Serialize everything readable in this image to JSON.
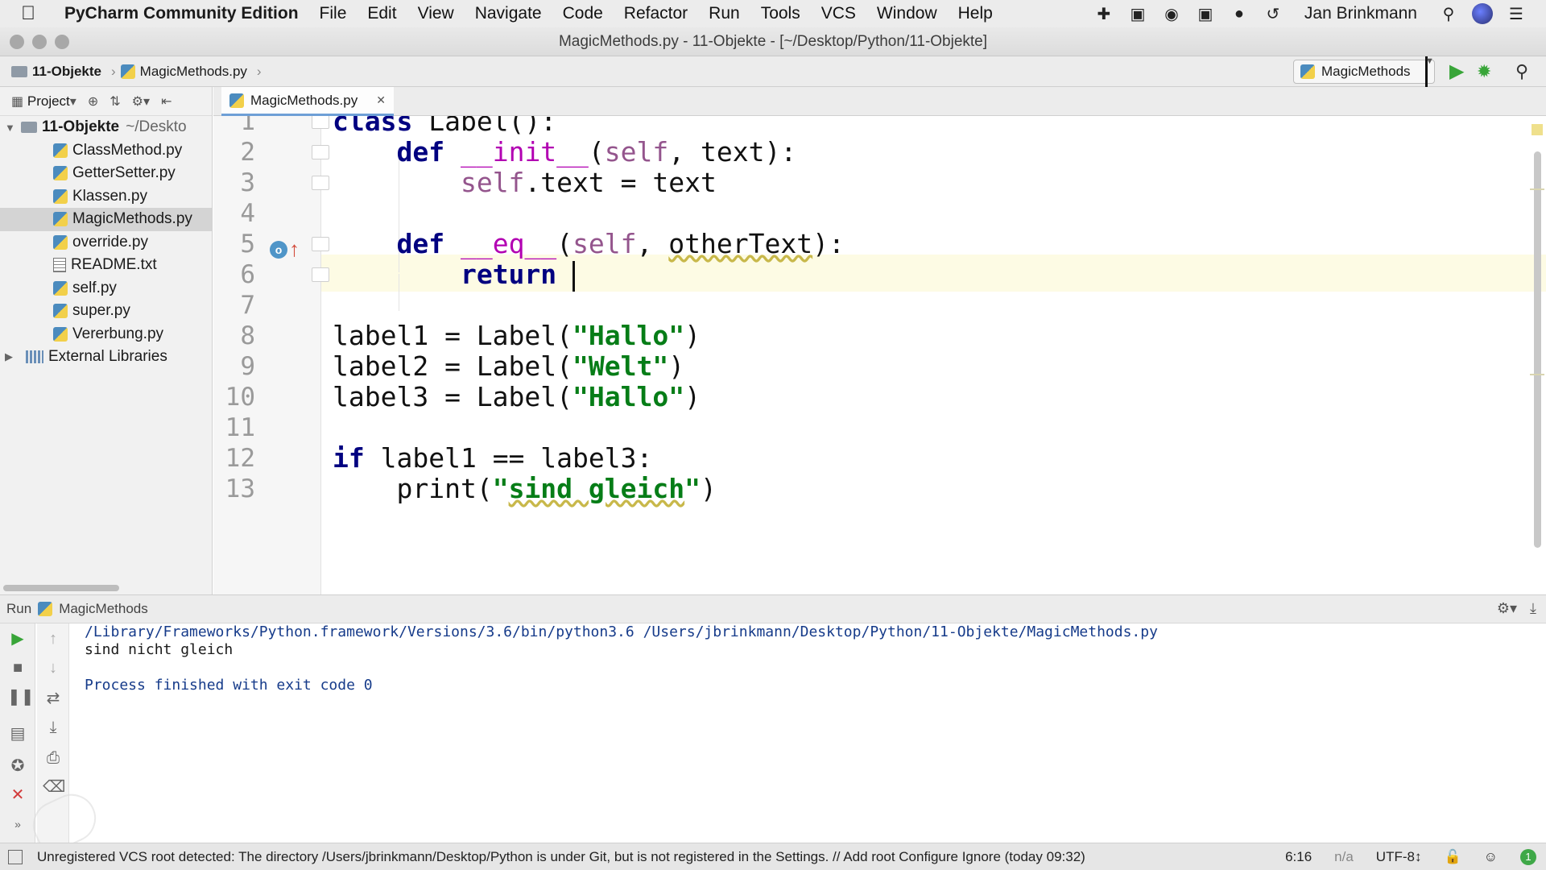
{
  "menubar": {
    "apple_icon": "apple-icon",
    "app_name": "PyCharm Community Edition",
    "items": [
      "File",
      "Edit",
      "View",
      "Navigate",
      "Code",
      "Refactor",
      "Run",
      "Tools",
      "VCS",
      "Window",
      "Help"
    ],
    "user_name": "Jan Brinkmann"
  },
  "window": {
    "title": "MagicMethods.py - 11-Objekte - [~/Desktop/Python/11-Objekte]"
  },
  "navbar": {
    "breadcrumb": [
      "11-Objekte",
      "MagicMethods.py"
    ],
    "run_config": "MagicMethods"
  },
  "project": {
    "label": "Project",
    "root_name": "11-Objekte",
    "root_path": "~/Deskto",
    "files": [
      {
        "name": "ClassMethod.py",
        "type": "py"
      },
      {
        "name": "GetterSetter.py",
        "type": "py"
      },
      {
        "name": "Klassen.py",
        "type": "py"
      },
      {
        "name": "MagicMethods.py",
        "type": "py",
        "selected": true
      },
      {
        "name": "override.py",
        "type": "py"
      },
      {
        "name": "README.txt",
        "type": "txt"
      },
      {
        "name": "self.py",
        "type": "py"
      },
      {
        "name": "super.py",
        "type": "py"
      },
      {
        "name": "Vererbung.py",
        "type": "py"
      }
    ],
    "external_libraries": "External Libraries"
  },
  "editor": {
    "tab_label": "MagicMethods.py",
    "line_numbers": [
      "1",
      "2",
      "3",
      "4",
      "5",
      "6",
      "7",
      "8",
      "9",
      "10",
      "11",
      "12",
      "13"
    ],
    "current_line": 6,
    "cursor_position": "6:16"
  },
  "run_panel": {
    "label": "Run",
    "config_name": "MagicMethods",
    "console_lines": [
      "/Library/Frameworks/Python.framework/Versions/3.6/bin/python3.6 /Users/jbrinkmann/Desktop/Python/11-Objekte/MagicMethods.py",
      "sind nicht gleich",
      "",
      "Process finished with exit code 0"
    ]
  },
  "statusbar": {
    "message": "Unregistered VCS root detected: The directory /Users/jbrinkmann/Desktop/Python is under Git, but is not registered in the Settings. // Add root  Configure  Ignore (today 09:32)",
    "position": "6:16",
    "line_separator": "n/a",
    "encoding": "UTF-8↕",
    "notifications": "1"
  }
}
